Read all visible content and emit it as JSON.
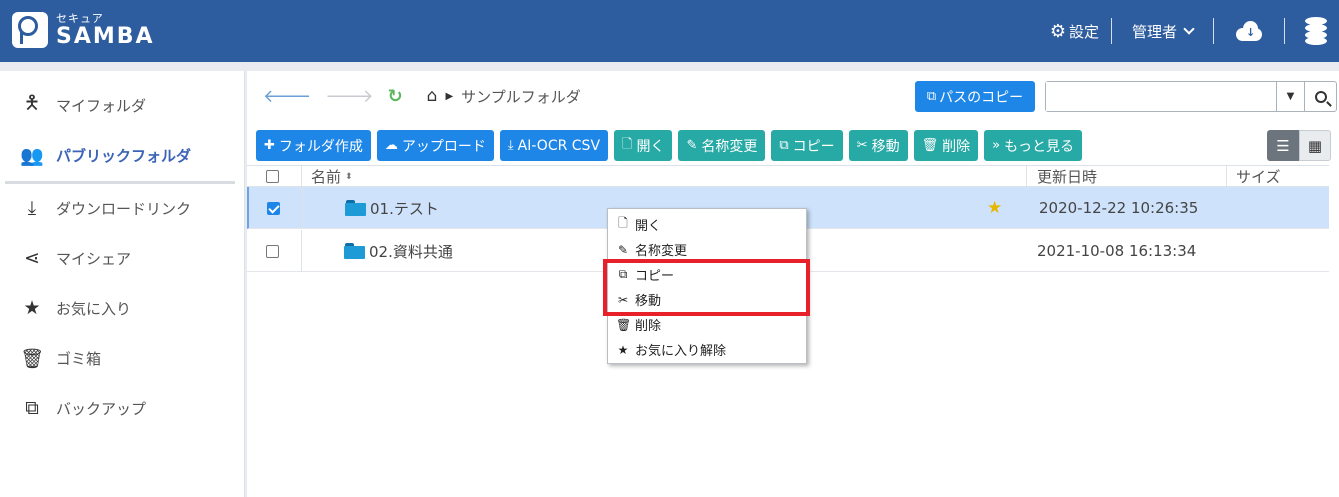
{
  "header": {
    "logo_small": "セキュア",
    "logo_big": "SAMBA",
    "settings_label": "設定",
    "user_label": "管理者"
  },
  "sidebar": {
    "items": [
      {
        "label": "マイフォルダ",
        "icon": "person-icon"
      },
      {
        "label": "パブリックフォルダ",
        "icon": "users-icon"
      },
      {
        "label": "ダウンロードリンク",
        "icon": "download-icon"
      },
      {
        "label": "マイシェア",
        "icon": "share-icon"
      },
      {
        "label": "お気に入り",
        "icon": "star-icon"
      },
      {
        "label": "ゴミ箱",
        "icon": "trash-icon"
      },
      {
        "label": "バックアップ",
        "icon": "backup-icon"
      }
    ]
  },
  "breadcrumb": {
    "folder": "サンプルフォルダ"
  },
  "path_copy_label": "パスのコピー",
  "search": {
    "value": "",
    "placeholder": ""
  },
  "toolbar": {
    "new_folder": "フォルダ作成",
    "upload": "アップロード",
    "ai_ocr": "AI-OCR CSV",
    "open": "開く",
    "rename": "名称変更",
    "copy": "コピー",
    "move": "移動",
    "delete": "削除",
    "more": "もっと見る"
  },
  "table": {
    "headers": {
      "name": "名前",
      "updated": "更新日時",
      "size": "サイズ"
    },
    "rows": [
      {
        "name": "01.テスト",
        "updated": "2020-12-22 10:26:35",
        "size": "",
        "checked": true,
        "favorite": true
      },
      {
        "name": "02.資料共通",
        "updated": "2021-10-08 16:13:34",
        "size": "",
        "checked": false,
        "favorite": false
      }
    ]
  },
  "context_menu": {
    "items": [
      {
        "label": "開く",
        "icon": "file-icon"
      },
      {
        "label": "名称変更",
        "icon": "pencil-icon"
      },
      {
        "label": "コピー",
        "icon": "copy-icon"
      },
      {
        "label": "移動",
        "icon": "scissors-icon"
      },
      {
        "label": "削除",
        "icon": "trash-icon"
      },
      {
        "label": "お気に入り解除",
        "icon": "star-icon"
      }
    ]
  },
  "colors": {
    "header_bg": "#2d5d9e",
    "primary_button": "#1e86e6",
    "teal_button": "#27a9a5",
    "selected_row": "#cfe2fb",
    "highlight_box": "#e8202a",
    "favorite_star": "#e6b800"
  }
}
